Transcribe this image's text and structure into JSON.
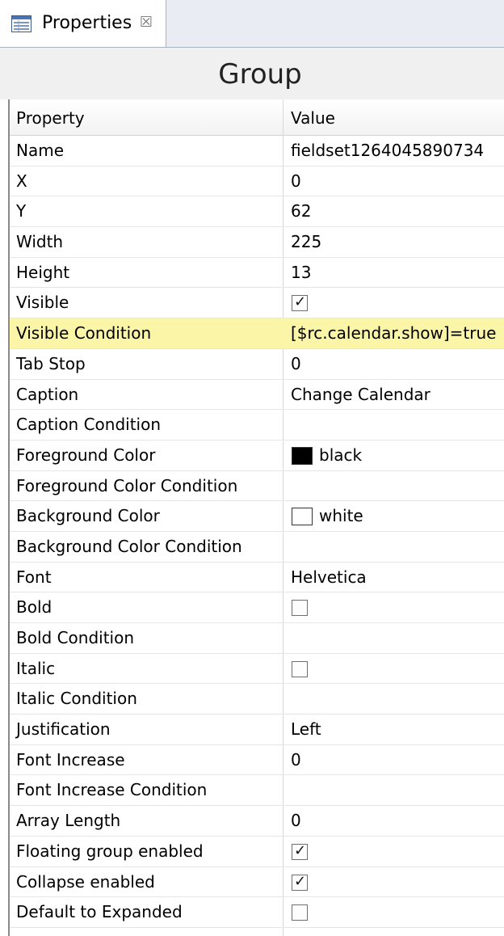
{
  "tab": {
    "label": "Properties",
    "icon": "properties-icon",
    "close_icon": "close-icon",
    "close_glyph": "☒"
  },
  "header": {
    "title": "Group"
  },
  "table": {
    "columns": {
      "property": "Property",
      "value": "Value"
    },
    "rows": [
      {
        "name": "Name",
        "kind": "text",
        "value": "fieldset1264045890734"
      },
      {
        "name": "X",
        "kind": "text",
        "value": "0"
      },
      {
        "name": "Y",
        "kind": "text",
        "value": "62"
      },
      {
        "name": "Width",
        "kind": "text",
        "value": "225"
      },
      {
        "name": "Height",
        "kind": "text",
        "value": "13"
      },
      {
        "name": "Visible",
        "kind": "checkbox",
        "checked": true
      },
      {
        "name": "Visible Condition",
        "kind": "text",
        "value": "[$rc.calendar.show]=true",
        "highlighted": true
      },
      {
        "name": "Tab Stop",
        "kind": "text",
        "value": "0"
      },
      {
        "name": "Caption",
        "kind": "text",
        "value": "Change Calendar"
      },
      {
        "name": "Caption Condition",
        "kind": "text",
        "value": ""
      },
      {
        "name": "Foreground Color",
        "kind": "color",
        "value": "black",
        "color": "#000000"
      },
      {
        "name": "Foreground Color Condition",
        "kind": "text",
        "value": ""
      },
      {
        "name": "Background Color",
        "kind": "color",
        "value": "white",
        "color": "#ffffff"
      },
      {
        "name": "Background Color Condition",
        "kind": "text",
        "value": ""
      },
      {
        "name": "Font",
        "kind": "text",
        "value": "Helvetica"
      },
      {
        "name": "Bold",
        "kind": "checkbox",
        "checked": false
      },
      {
        "name": "Bold Condition",
        "kind": "text",
        "value": ""
      },
      {
        "name": "Italic",
        "kind": "checkbox",
        "checked": false
      },
      {
        "name": "Italic Condition",
        "kind": "text",
        "value": ""
      },
      {
        "name": "Justification",
        "kind": "text",
        "value": "Left"
      },
      {
        "name": "Font Increase",
        "kind": "text",
        "value": "0"
      },
      {
        "name": "Font Increase Condition",
        "kind": "text",
        "value": ""
      },
      {
        "name": "Array Length",
        "kind": "text",
        "value": "0"
      },
      {
        "name": "Floating group enabled",
        "kind": "checkbox",
        "checked": true
      },
      {
        "name": "Collapse enabled",
        "kind": "checkbox",
        "checked": true
      },
      {
        "name": "Default to Expanded",
        "kind": "checkbox",
        "checked": false
      }
    ]
  },
  "colors": {
    "highlight": "#fbf5a8",
    "checkmark_glyph": "✓"
  }
}
